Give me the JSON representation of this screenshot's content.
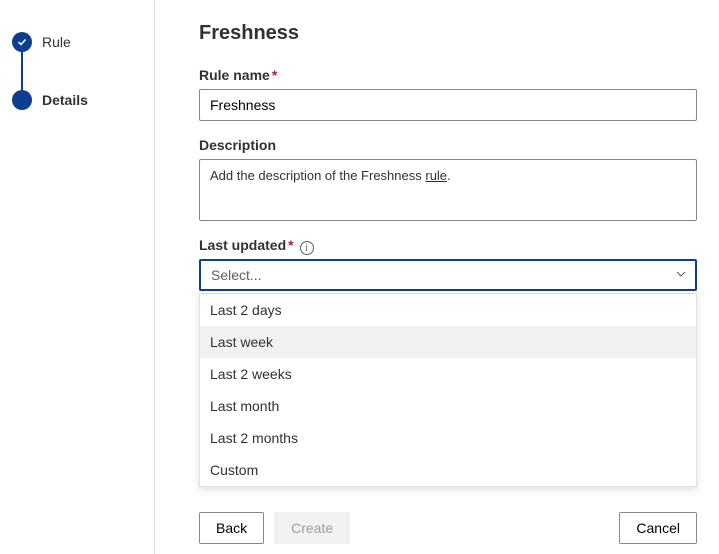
{
  "sidebar": {
    "steps": [
      {
        "label": "Rule",
        "state": "complete"
      },
      {
        "label": "Details",
        "state": "current"
      }
    ]
  },
  "page": {
    "title": "Freshness"
  },
  "form": {
    "ruleName": {
      "label": "Rule name",
      "value": "Freshness"
    },
    "description": {
      "label": "Description",
      "prefix": "Add the description of the Freshness ",
      "underlined": "rule",
      "suffix": "."
    },
    "lastUpdated": {
      "label": "Last updated",
      "placeholder": "Select...",
      "options": [
        "Last 2 days",
        "Last week",
        "Last 2 weeks",
        "Last month",
        "Last 2 months",
        "Custom"
      ],
      "hoveredIndex": 1
    }
  },
  "footer": {
    "back": "Back",
    "create": "Create",
    "cancel": "Cancel"
  }
}
